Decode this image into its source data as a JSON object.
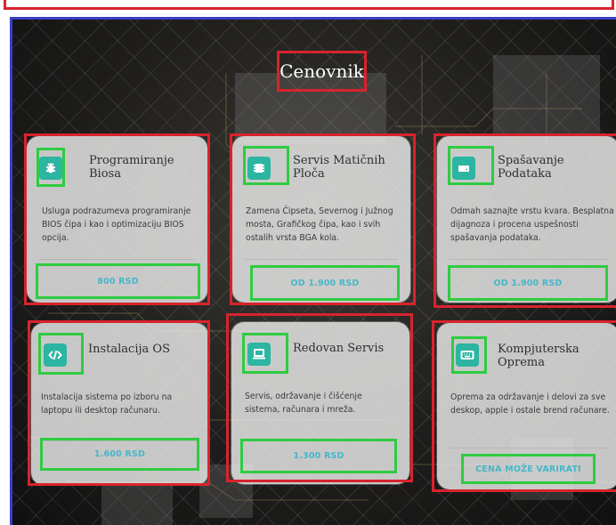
{
  "section": {
    "title": "Cenovnik"
  },
  "cards": [
    {
      "icon": "bug-icon",
      "title": "Programiranje Biosa",
      "description": "Usluga podrazumeva programiranje BIOS čipa i kao i optimizaciju BIOS opcija.",
      "price": "800 RSD"
    },
    {
      "icon": "chip-icon",
      "title": "Servis Matičnih Ploča",
      "description": "Zamena Čipseta, Severnog i Južnog mosta, Grafičkog čipa, kao i svih ostalih vrsta BGA kola.",
      "price": "OD 1.900 RSD"
    },
    {
      "icon": "hard-drive-icon",
      "title": "Spašavanje Podataka",
      "description": "Odmah saznajte vrstu kvara. Besplatna dijagnoza i procena uspešnosti spašavanja podataka.",
      "price": "OD 1.900 RSD"
    },
    {
      "icon": "code-icon",
      "title": "Instalacija OS",
      "description": "Instalacija sistema po izboru na laptopu ili desktop računaru.",
      "price": "1.600 RSD"
    },
    {
      "icon": "laptop-icon",
      "title": "Redovan Servis",
      "description": "Servis, održavanje i čišćenje sistema, računara i mreža.",
      "price": "1.300 RSD"
    },
    {
      "icon": "keyboard-icon",
      "title": "Kompjuterska Oprema",
      "description": "Oprema za održavanje i delovi za sve deskop, apple i ostale brend računare.",
      "price": "CENA MOŽE VARIRATI"
    }
  ],
  "colors": {
    "accent": "#2bb5a2",
    "price_text": "#45b7c9",
    "outline_red": "#d9232d",
    "outline_green": "#2ecc40",
    "outline_blue": "#3b3fc4"
  }
}
